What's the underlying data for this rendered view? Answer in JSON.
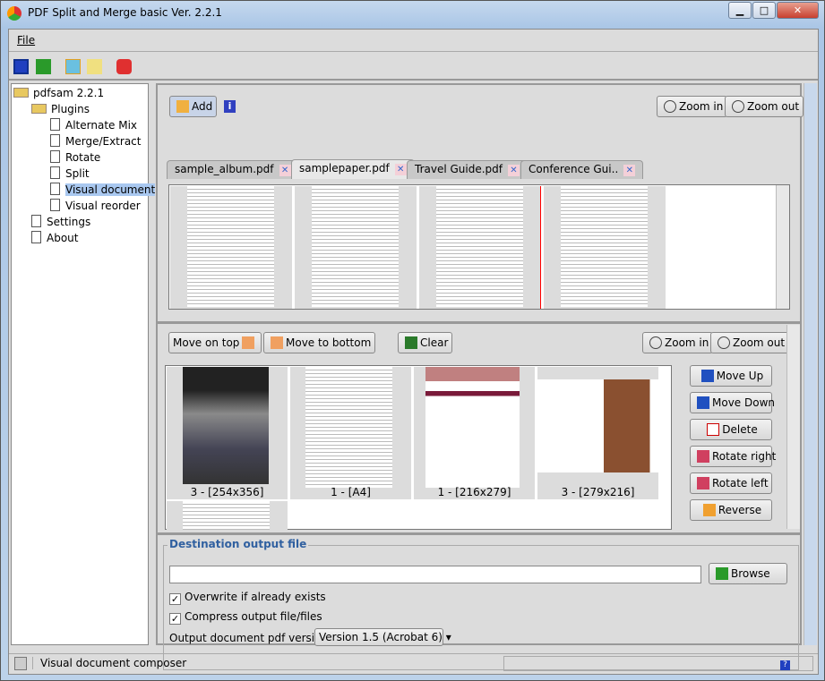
{
  "window": {
    "title": "PDF Split and Merge basic Ver. 2.2.1",
    "minimize": "▁",
    "maximize": "□",
    "close": "✕"
  },
  "menu": {
    "file": "File"
  },
  "toolbar": {
    "icons": [
      "save-icon",
      "open-icon",
      "duplicate-icon",
      "clear-icon",
      "exit-icon"
    ]
  },
  "tree": {
    "root": "pdfsam 2.2.1",
    "plugins": "Plugins",
    "items": [
      "Alternate Mix",
      "Merge/Extract",
      "Rotate",
      "Split",
      "Visual document",
      "Visual reorder"
    ],
    "settings": "Settings",
    "about": "About",
    "selected": "Visual document"
  },
  "top": {
    "add": "Add",
    "info": "i",
    "zoom_in": "Zoom in",
    "zoom_out": "Zoom out",
    "tabs": [
      {
        "label": "sample_album.pdf"
      },
      {
        "label": "samplepaper.pdf",
        "active": true
      },
      {
        "label": "Travel Guide.pdf"
      },
      {
        "label": "Conference Gui.."
      }
    ]
  },
  "middle": {
    "move_top": "Move on top",
    "move_bottom": "Move to bottom",
    "clear": "Clear",
    "zoom_in": "Zoom in",
    "zoom_out": "Zoom out",
    "pages": [
      "3 - [254x356]",
      "1 - [A4]",
      "1 - [216x279]",
      "3 - [279x216]"
    ],
    "side": [
      "Move Up",
      "Move Down",
      "Delete",
      "Rotate right",
      "Rotate left",
      "Reverse"
    ]
  },
  "destination": {
    "title": "Destination output file",
    "value": "",
    "browse": "Browse",
    "overwrite": "Overwrite if already exists",
    "overwrite_checked": true,
    "compress": "Compress output file/files",
    "compress_checked": true,
    "version_label": "Output document pdf version:",
    "version": "Version 1.5 (Acrobat 6)",
    "help": "?"
  },
  "status": {
    "text": "Visual document composer"
  }
}
